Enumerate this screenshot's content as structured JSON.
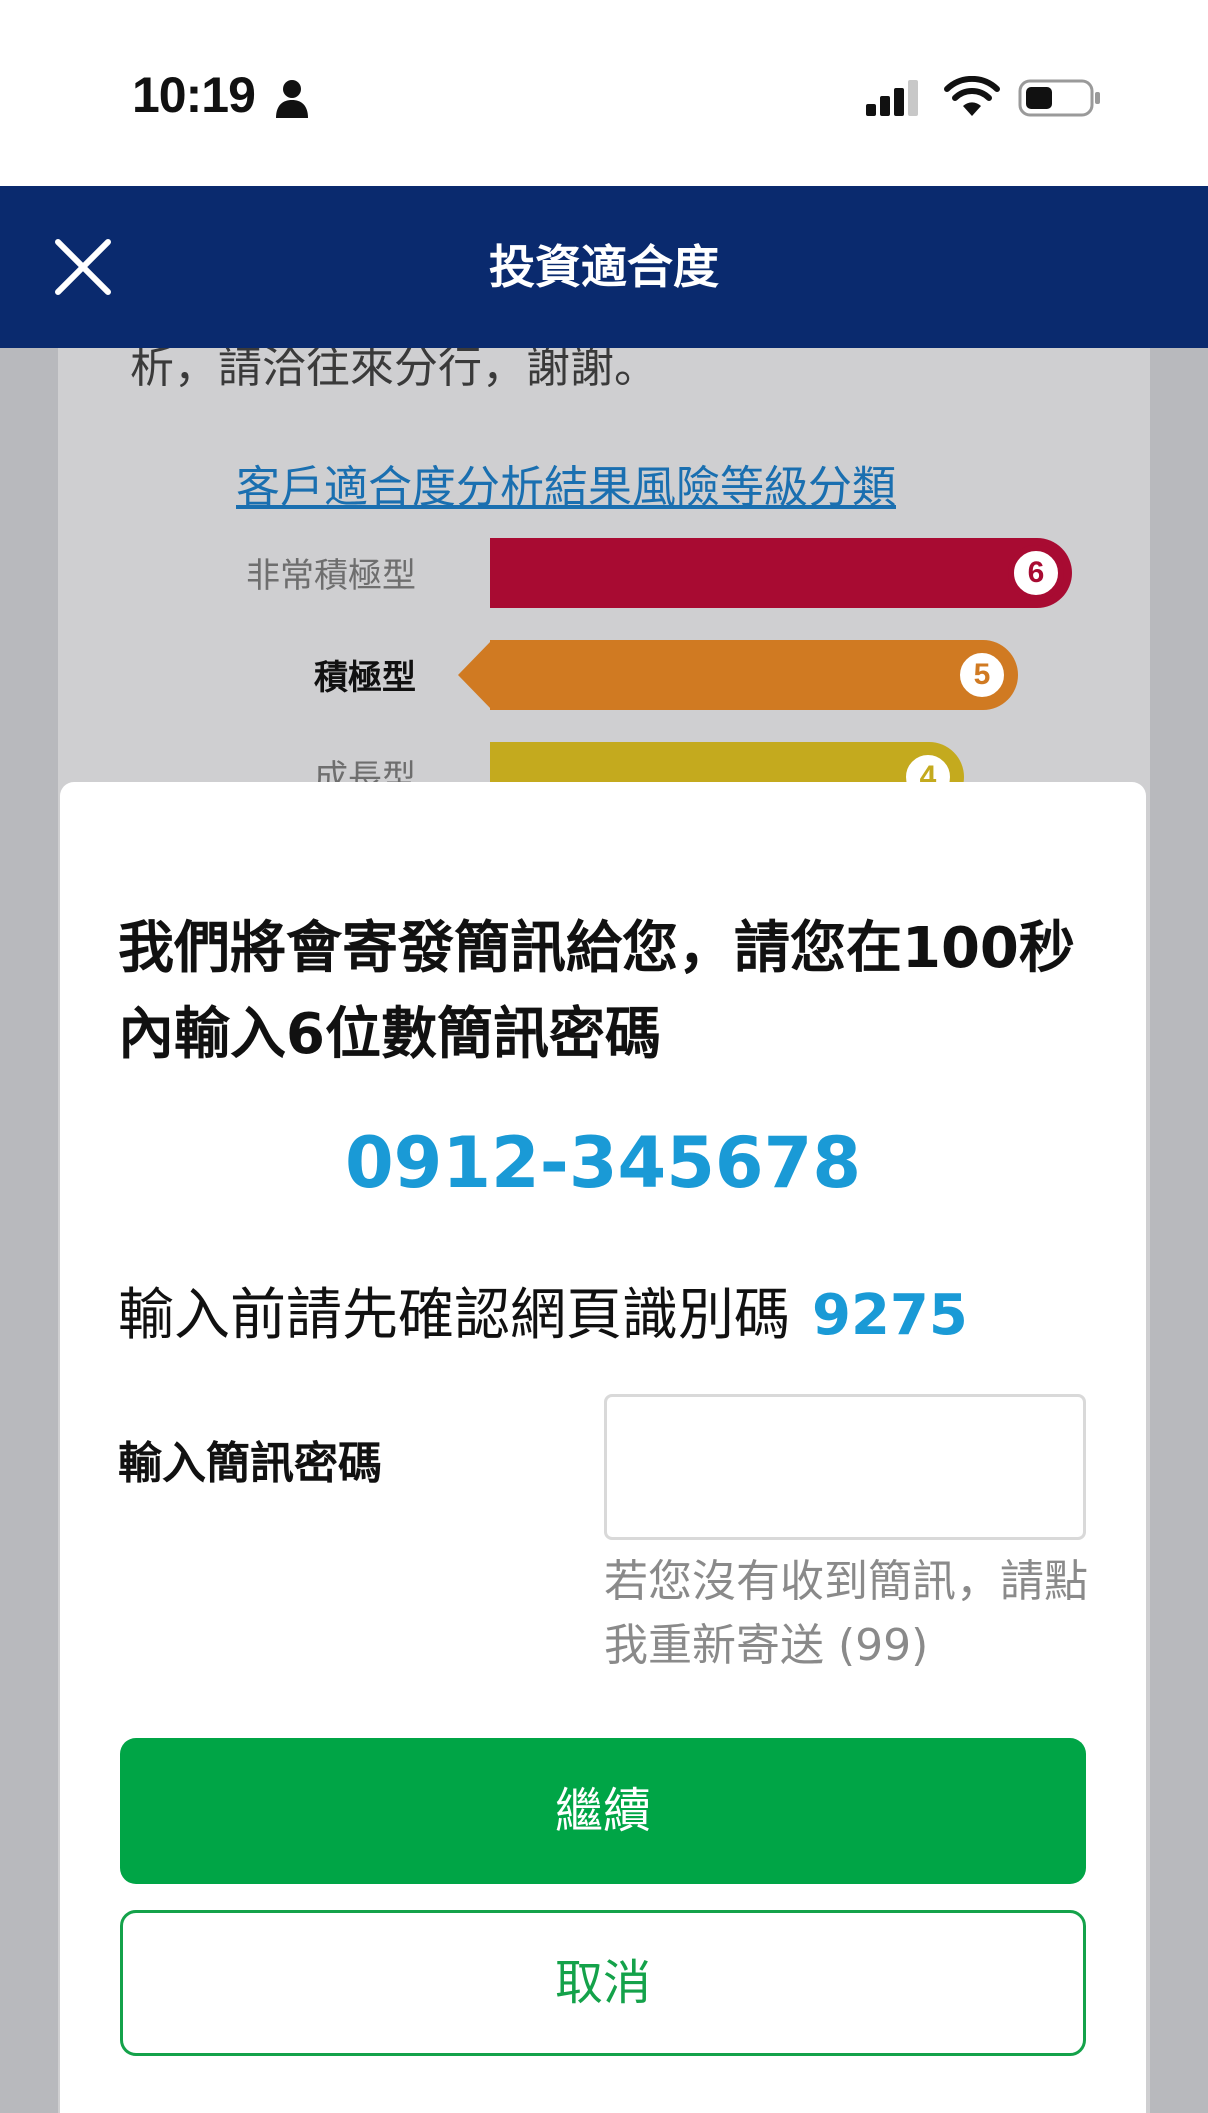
{
  "status_bar": {
    "time": "10:19",
    "icons": [
      "person-icon",
      "signal-icon",
      "wifi-icon",
      "battery-icon"
    ]
  },
  "header": {
    "title": "投資適合度",
    "close_icon": "close-icon",
    "background_color": "#0a2a6e"
  },
  "background_page": {
    "text_fragment": "析，請洽往來分行，謝謝。",
    "link_text": "客戶適合度分析結果風險等級分類",
    "risk_levels": [
      {
        "label": "非常積極型",
        "level": "6",
        "color": "#a80b32"
      },
      {
        "label": "積極型",
        "level": "5",
        "color": "#d07a22"
      },
      {
        "label": "成長型",
        "level": "4",
        "color": "#c4aa1e"
      }
    ]
  },
  "modal": {
    "message": "我們將會寄發簡訊給您，請您在100秒內輸入6位數簡訊密碼",
    "phone_number": "0912-345678",
    "verify_label": "輸入前請先確認網頁識別碼",
    "verify_code": "9275",
    "sms_label": "輸入簡訊密碼",
    "sms_input_value": "",
    "resend_text": "若您沒有收到簡訊，請點我重新寄送 (99)",
    "continue_label": "繼續",
    "cancel_label": "取消",
    "accent_color": "#1a9ad6",
    "primary_color": "#00a546"
  }
}
